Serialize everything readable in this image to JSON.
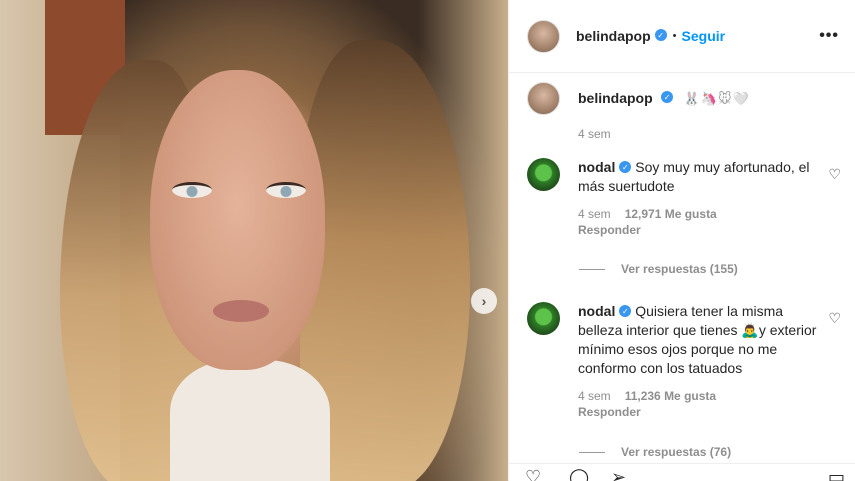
{
  "header": {
    "username": "belindapop",
    "verified_icon": "verified-badge-icon",
    "separator": "•",
    "follow_label": "Seguir",
    "more_icon": "more-options-icon"
  },
  "photo": {
    "next_icon": "chevron-right-icon"
  },
  "caption": {
    "username": "belindapop",
    "emojis": "🐰🦄🐭🤍",
    "time": "4 sem"
  },
  "comments": [
    {
      "username": "nodal",
      "text": "Soy muy muy afortunado, el más suertudote",
      "time": "4 sem",
      "likes": "12,971 Me gusta",
      "reply_label": "Responder",
      "view_replies": "Ver respuestas (155)"
    },
    {
      "username": "nodal",
      "text": "Quisiera tener la misma belleza interior que tienes 🙇‍♂️y exterior mínimo esos ojos porque no me conformo con los tatuados",
      "time": "4 sem",
      "likes": "11,236 Me gusta",
      "reply_label": "Responder",
      "view_replies": "Ver respuestas (76)"
    }
  ],
  "colors": {
    "accent": "#0095f6",
    "verified": "#3897f0",
    "muted": "#8e8e8e"
  }
}
